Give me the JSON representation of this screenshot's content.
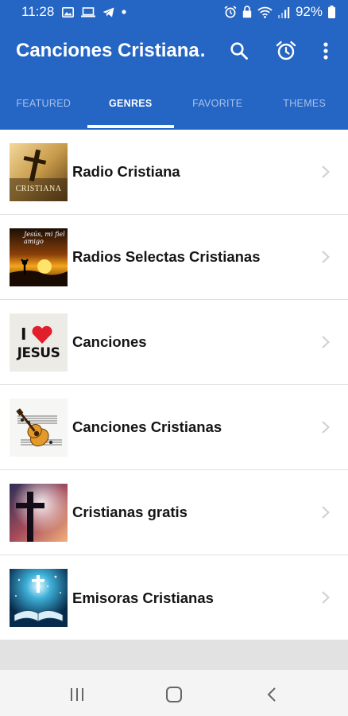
{
  "status_bar": {
    "time": "11:28",
    "battery": "92%",
    "icons": [
      "image-icon",
      "laptop-icon",
      "telegram-icon",
      "dot-icon",
      "alarm-icon",
      "lock-icon",
      "wifi-icon",
      "signal-icon",
      "battery-icon"
    ]
  },
  "toolbar": {
    "title": "Canciones Cristiana…",
    "icons": [
      "search-icon",
      "alarm-icon",
      "more-vert-icon"
    ]
  },
  "tabs": [
    {
      "label": "FEATURED",
      "active": false
    },
    {
      "label": "GENRES",
      "active": true
    },
    {
      "label": "FAVORITE",
      "active": false
    },
    {
      "label": "THEMES",
      "active": false
    }
  ],
  "list": {
    "items": [
      {
        "label": "Radio Cristiana",
        "thumb_text": "CRISTIANA"
      },
      {
        "label": "Radios Selectas Cristianas",
        "thumb_text": "Jesús, mi fiel amigo"
      },
      {
        "label": "Canciones",
        "thumb_text_1": "I",
        "thumb_text_2": "JESUS"
      },
      {
        "label": "Canciones Cristianas"
      },
      {
        "label": "Cristianas gratis"
      },
      {
        "label": "Emisoras Cristianas"
      }
    ]
  },
  "colors": {
    "primary": "#2565c3",
    "tab_inactive": "#a9c2ea",
    "heart": "#e21d2c"
  },
  "nav_bar": {
    "icons": [
      "recent-apps-icon",
      "home-icon",
      "back-icon"
    ]
  }
}
